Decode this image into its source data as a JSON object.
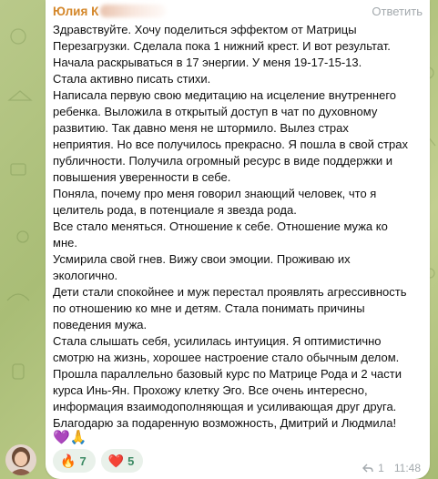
{
  "message": {
    "sender_visible": "Юлия К",
    "reply_label": "Ответить",
    "lines": [
      "Здравствуйте. Хочу поделиться эффектом от Матрицы",
      "Перезагрузки. Сделала пока 1 нижний крест. И вот результат.",
      "Начала раскрываться в 17 энергии. У меня 19-17-15-13.",
      "Стала активно писать стихи.",
      "Написала первую свою медитацию на исцеление внутреннего",
      "ребенка. Выложила в открытый доступ в чат по духовному",
      "развитию. Так давно меня не штормило. Вылез страх",
      "неприятия. Но все получилось прекрасно. Я пошла в свой страх",
      "публичности. Получила огромный ресурс в виде поддержки и",
      "повышения уверенности в себе.",
      "Поняла, почему про меня говорил знающий человек, что я",
      "целитель рода, в потенциале я звезда рода.",
      "Все стало меняться. Отношение к себе. Отношение мужа ко",
      "мне.",
      "Усмирила свой гнев. Вижу свои эмоции. Проживаю их",
      "экологично.",
      "Дети стали спокойнее и муж перестал проявлять агрессивность",
      "по отношению ко мне и детям. Стала понимать причины",
      "поведения мужа.",
      "Стала слышать себя, усилилась интуиция. Я оптимистично",
      "смотрю на жизнь, хорошее настроение стало обычным делом.",
      "Прошла параллельно базовый курс по Матрице Рода и 2 части",
      "курса Инь-Ян. Прохожу клетку Эго. Все очень интересно,",
      "информация взаимодополняющая и усиливающая друг друга.",
      "Благодарю за подаренную возможность, Дмитрий и Людмила!"
    ],
    "inline_emoji": "💜🙏",
    "reactions": [
      {
        "emoji": "🔥",
        "count": "7"
      },
      {
        "emoji": "❤️",
        "count": "5"
      }
    ],
    "reply_count": "1",
    "time": "11:48"
  },
  "colors": {
    "sender": "#d4872a",
    "meta": "#a3a9ad",
    "reaction_count": "#3c8a64"
  }
}
